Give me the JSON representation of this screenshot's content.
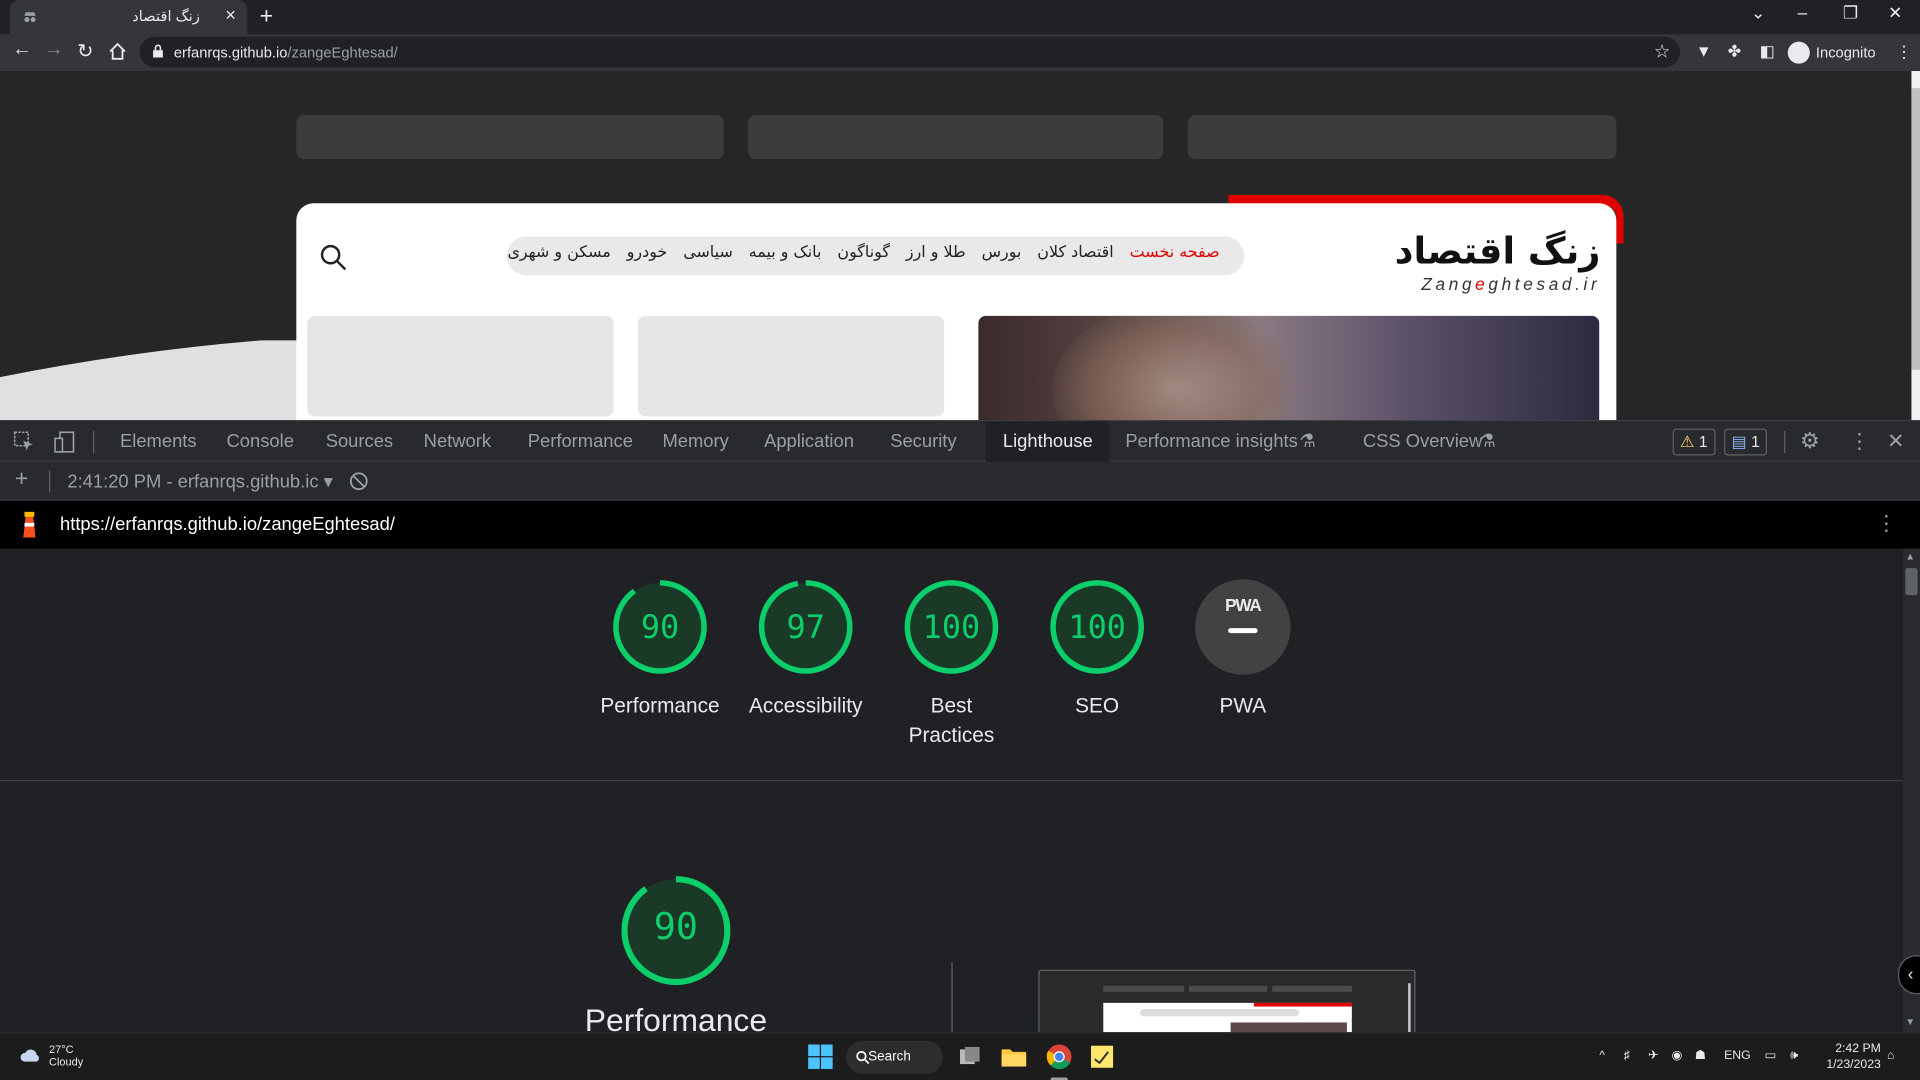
{
  "browser": {
    "tab_title": "زنگ اقتصاد",
    "url_host": "erfanrqs.github.io",
    "url_path": "/zangeEghtesad/",
    "profile_label": "Incognito"
  },
  "site": {
    "nav_links": [
      {
        "label": "صفحه نخست",
        "active": true
      },
      {
        "label": "اقتصاد کلان",
        "active": false
      },
      {
        "label": "بورس",
        "active": false
      },
      {
        "label": "طلا و ارز",
        "active": false
      },
      {
        "label": "گوناگون",
        "active": false
      },
      {
        "label": "بانک و بیمه",
        "active": false
      },
      {
        "label": "سیاسی",
        "active": false
      },
      {
        "label": "خودرو",
        "active": false
      },
      {
        "label": "مسکن و شهری",
        "active": false
      }
    ],
    "logo_text": "زنگ اقتصاد",
    "logo_latin_before": "Zang",
    "logo_latin_accent": "e",
    "logo_latin_after": "ghtesad.ir",
    "accent_color": "#e10000"
  },
  "devtools": {
    "tabs": [
      "Elements",
      "Console",
      "Sources",
      "Network",
      "Performance",
      "Memory",
      "Application",
      "Security",
      "Lighthouse",
      "Performance insights",
      "CSS Overview"
    ],
    "active_tab": "Lighthouse",
    "warnings_count": "1",
    "messages_count": "1",
    "report_selector": "2:41:20 PM - erfanrqs.github.ic",
    "report_url": "https://erfanrqs.github.io/zangeEghtesad/"
  },
  "lighthouse": {
    "scores": [
      {
        "label": "Performance",
        "score": "90",
        "value": 90
      },
      {
        "label": "Accessibility",
        "score": "97",
        "value": 97
      },
      {
        "label": "Best Practices",
        "score": "100",
        "value": 100
      },
      {
        "label": "SEO",
        "score": "100",
        "value": 100
      }
    ],
    "pwa_label": "PWA",
    "pwa_badge": "PWA",
    "main_score": "90",
    "main_value": 90,
    "main_label": "Performance",
    "pass_color": "#0cce6b"
  },
  "taskbar": {
    "temperature": "27°C",
    "weather": "Cloudy",
    "search_label": "Search",
    "language": "ENG",
    "time": "2:42 PM",
    "date": "1/23/2023"
  }
}
